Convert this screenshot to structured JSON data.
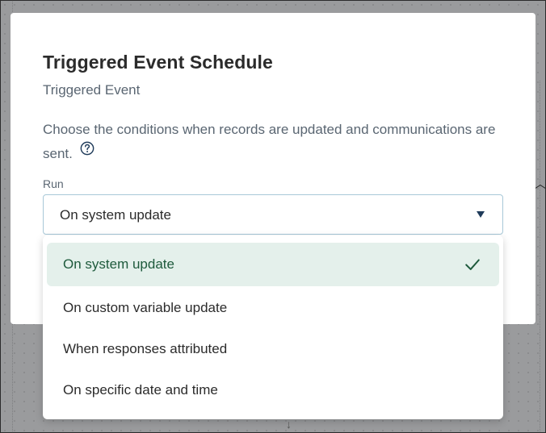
{
  "modal": {
    "title": "Triggered Event Schedule",
    "subtitle": "Triggered Event",
    "description": "Choose the conditions when records are updated and communications are sent.",
    "help_icon": "question-circle-icon"
  },
  "run_field": {
    "label": "Run",
    "selected_value": "On system update",
    "caret_icon": "triangle-down-icon"
  },
  "dropdown": {
    "options": [
      {
        "label": "On system update",
        "selected": true
      },
      {
        "label": "On custom variable update",
        "selected": false
      },
      {
        "label": "When responses attributed",
        "selected": false
      },
      {
        "label": "On specific date and time",
        "selected": false
      }
    ],
    "check_icon": "checkmark-icon"
  },
  "colors": {
    "accent": "#1e5a3c",
    "selected_bg": "#e4f0eb",
    "select_border": "#a8c8d8",
    "overlay": "#9a9b9d"
  }
}
